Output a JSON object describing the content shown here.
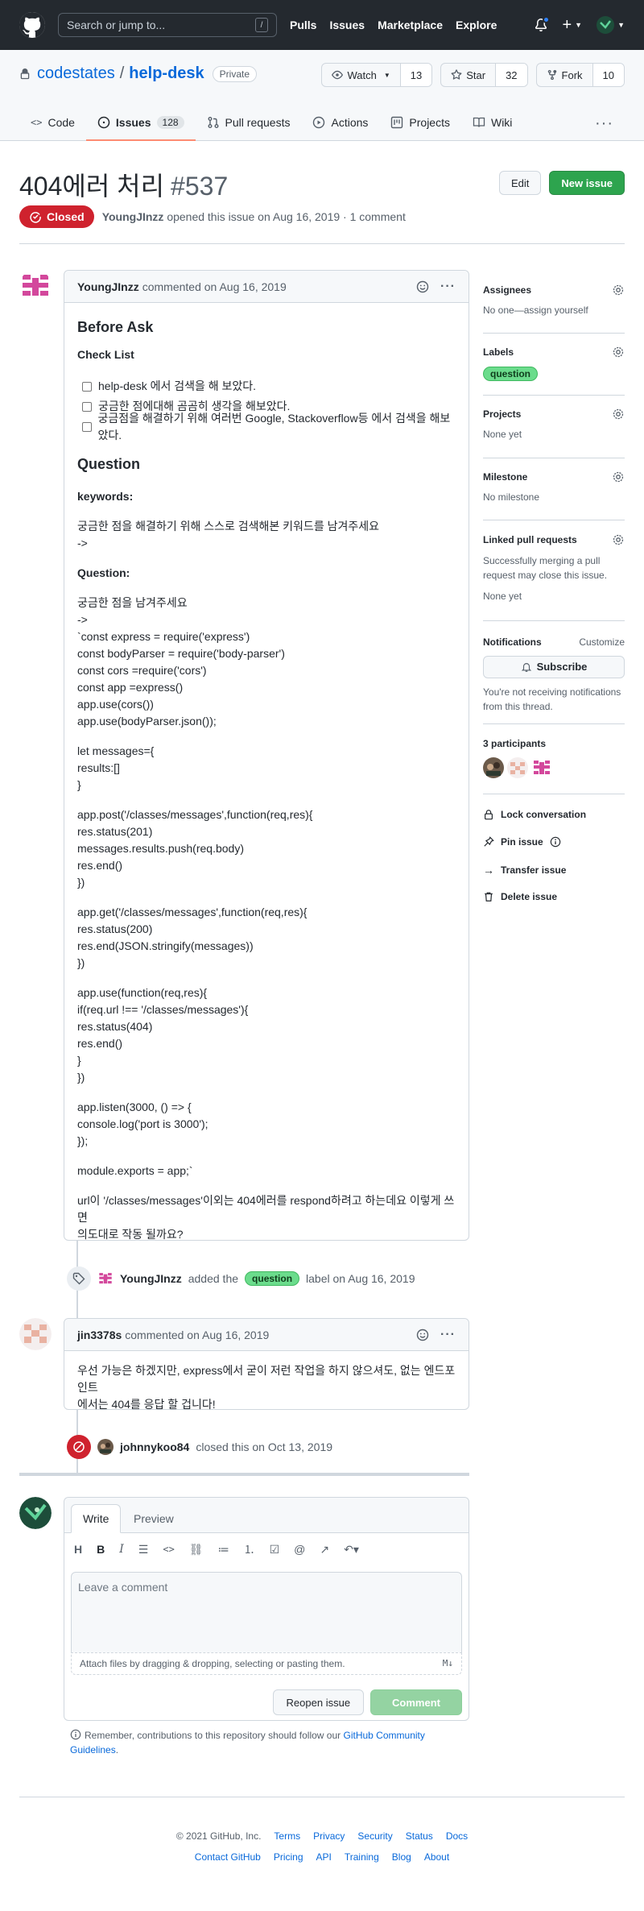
{
  "header": {
    "search_placeholder": "Search or jump to...",
    "search_shortcut": "/",
    "nav": [
      "Pulls",
      "Issues",
      "Marketplace",
      "Explore"
    ]
  },
  "repo": {
    "owner": "codestates",
    "separator": "/",
    "name": "help-desk",
    "visibility": "Private",
    "watch_label": "Watch",
    "watch_count": "13",
    "star_label": "Star",
    "star_count": "32",
    "fork_label": "Fork",
    "fork_count": "10",
    "tabs": [
      {
        "label": "Code"
      },
      {
        "label": "Issues",
        "count": "128"
      },
      {
        "label": "Pull requests"
      },
      {
        "label": "Actions"
      },
      {
        "label": "Projects"
      },
      {
        "label": "Wiki"
      }
    ],
    "more": "···"
  },
  "issue": {
    "title": "404에러 처리",
    "number": "#537",
    "edit_label": "Edit",
    "new_issue_label": "New issue",
    "state": "Closed",
    "author": "YoungJInzz",
    "meta": "opened this issue on Aug 16, 2019 · 1 comment"
  },
  "comments": [
    {
      "author": "YoungJInzz",
      "meta": "commented on Aug 16, 2019",
      "h_before": "Before Ask",
      "h_checklist": "Check List",
      "tasks": [
        "help-desk 에서 검색을 해 보았다.",
        "궁금한 점에대해 곰곰히 생각을 해보았다.",
        "궁금점을 해결하기 위해 여러번 Google, Stackoverflow등 에서 검색을 해보았다."
      ],
      "h_question": "Question",
      "h_keywords": "keywords:",
      "keywords_text": [
        "궁금한 점을 해결하기 위해 스스로 검색해본 키워드를 남겨주세요",
        "->"
      ],
      "h_question2": "Question:",
      "question_blocks": [
        [
          "궁금한 점을 남겨주세요",
          "->",
          "`const express = require('express')",
          "const bodyParser = require('body-parser')",
          "const cors =require('cors')",
          "const app =express()",
          "app.use(cors())",
          "app.use(bodyParser.json());"
        ],
        [
          "let messages={",
          "results:[]",
          "}"
        ],
        [
          "app.post('/classes/messages',function(req,res){",
          "res.status(201)",
          "messages.results.push(req.body)",
          "res.end()",
          "})"
        ],
        [
          "app.get('/classes/messages',function(req,res){",
          "res.status(200)",
          "res.end(JSON.stringify(messages))",
          "})"
        ],
        [
          "app.use(function(req,res){",
          "if(req.url !== '/classes/messages'){",
          "res.status(404)",
          "res.end()",
          "}",
          "})"
        ],
        [
          "app.listen(3000, () => {",
          "console.log('port is 3000');",
          "});"
        ],
        [
          "module.exports = app;`"
        ],
        [
          "url이 '/classes/messages'이외는 404에러를 respond하려고 하는데요 이렇게 쓰면",
          "의도대로 작동 될까요?"
        ]
      ]
    },
    {
      "author": "jin3378s",
      "meta": "commented on Aug 16, 2019",
      "text": [
        "우선 가능은 하겠지만, express에서 굳이 저런 작업을 하지 않으셔도, 없는 엔드포인트",
        "에서는 404를 응답 할 겁니다!"
      ]
    }
  ],
  "events": {
    "label_actor": "YoungJInzz",
    "label_pre": "added the",
    "label_name": "question",
    "label_post": "label on Aug 16, 2019",
    "close_actor": "johnnykoo84",
    "close_text": "closed this on Oct 13, 2019"
  },
  "sidebar": {
    "assignees_h": "Assignees",
    "assignees_v": "No one—assign yourself",
    "labels_h": "Labels",
    "label": "question",
    "projects_h": "Projects",
    "projects_v": "None yet",
    "milestone_h": "Milestone",
    "milestone_v": "No milestone",
    "linked_h": "Linked pull requests",
    "linked_desc": [
      "Successfully merging a pull",
      "request may close this issue."
    ],
    "linked_v": "None yet",
    "notifications_h": "Notifications",
    "customize": "Customize",
    "subscribe": "Subscribe",
    "notif_desc": [
      "You're not receiving notifications",
      "from this thread."
    ],
    "participants_h": "3 participants",
    "lock": "Lock conversation",
    "pin": "Pin issue",
    "transfer": "Transfer issue",
    "delete": "Delete issue"
  },
  "composer": {
    "tab_write": "Write",
    "tab_preview": "Preview",
    "placeholder": "Leave a comment",
    "attach": "Attach files by dragging & dropping, selecting or pasting them.",
    "reopen": "Reopen issue",
    "comment": "Comment",
    "note_pre": "Remember, contributions to this repository should follow our",
    "note_link1": "GitHub Community",
    "note_link2": "Guidelines",
    "note_end": "."
  },
  "footer": {
    "copyright": "© 2021 GitHub, Inc.",
    "row1": [
      "Terms",
      "Privacy",
      "Security",
      "Status",
      "Docs"
    ],
    "row2": [
      "Contact GitHub",
      "Pricing",
      "API",
      "Training",
      "Blog",
      "About"
    ]
  },
  "colors": {
    "closed": "#cf222e",
    "green": "#2da44e",
    "label": "#6bdc8c",
    "link": "#0969da"
  }
}
